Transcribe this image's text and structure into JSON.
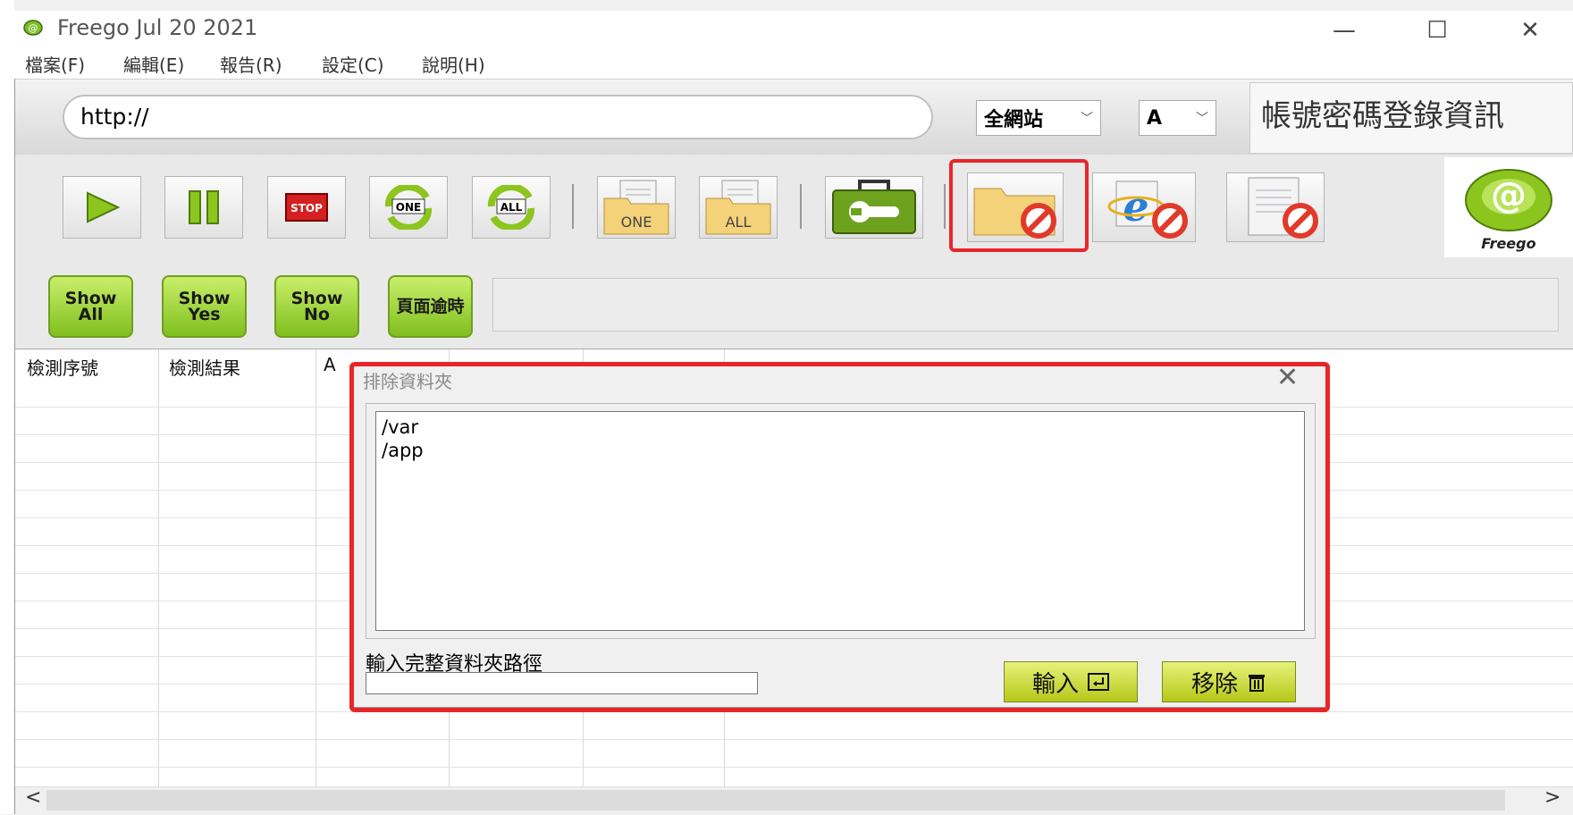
{
  "window": {
    "title": "Freego Jul 20 2021",
    "minimize": "—",
    "maximize": "☐",
    "close": "✕"
  },
  "menu": [
    "檔案(F)",
    "編輯(E)",
    "報告(R)",
    "設定(C)",
    "說明(H)"
  ],
  "url_bar": {
    "value": "http://",
    "scope_select": "全網站",
    "level_select": "A",
    "info_panel": "帳號密碼登錄資訊"
  },
  "toolbar": {
    "one_label": "ONE",
    "all_label": "ALL",
    "stop_label": "STOP",
    "logo_text": "Freego",
    "highlight_color": "#e8262a"
  },
  "filters": [
    "Show All",
    "Show Yes",
    "Show No",
    "頁面逾時"
  ],
  "grid": {
    "columns": [
      "檢測序號",
      "檢測結果",
      "A"
    ]
  },
  "dialog": {
    "title": "排除資料夾",
    "close": "✕",
    "folders": [
      "/var",
      "/app"
    ],
    "path_label": "輸入完整資料夾路徑",
    "path_value": "",
    "input_button": "輸入",
    "remove_button": "移除"
  },
  "scrollbar": {
    "left": "<",
    "right": ">"
  }
}
